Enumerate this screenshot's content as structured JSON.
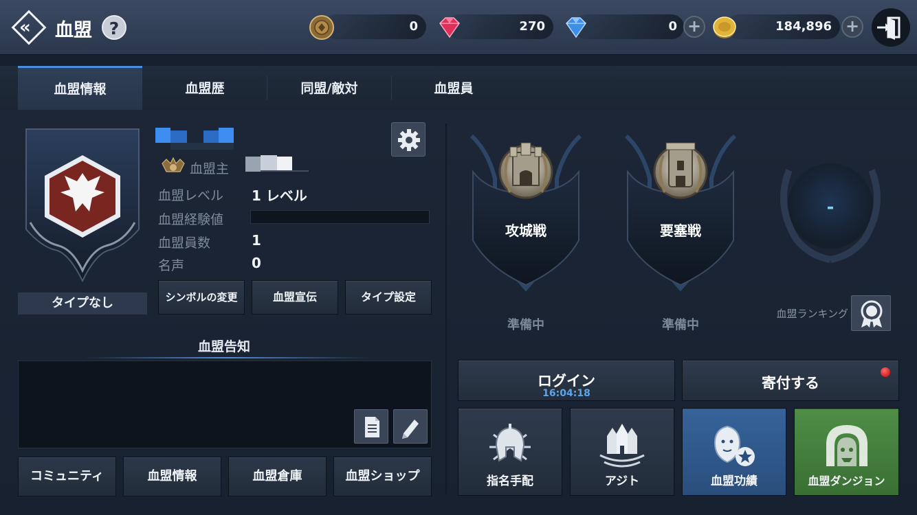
{
  "header": {
    "title": "血盟",
    "help_symbol": "?",
    "currencies": [
      {
        "icon": "medal-coin-icon",
        "value": "0",
        "color": "#b08a4a"
      },
      {
        "icon": "red-gem-icon",
        "value": "270",
        "color": "#e0305a"
      },
      {
        "icon": "blue-gem-icon",
        "value": "0",
        "color": "#3f8ee8",
        "has_plus": true
      },
      {
        "icon": "gold-coin-icon",
        "value": "184,896",
        "color": "#e2b43a",
        "has_plus": true
      }
    ]
  },
  "tabs": [
    {
      "label": "血盟情報",
      "active": true
    },
    {
      "label": "血盟歴",
      "active": false
    },
    {
      "label": "同盟/敵対",
      "active": false
    },
    {
      "label": "血盟員",
      "active": false
    }
  ],
  "clan": {
    "type_label": "タイプなし",
    "leader_label": "血盟主",
    "level_label": "血盟レベル",
    "level_value": "1 レベル",
    "exp_label": "血盟経験値",
    "exp_fraction": 0,
    "members_label": "血盟員数",
    "members_value": "1",
    "fame_label": "名声",
    "fame_value": "0",
    "buttons": {
      "symbol": "シンボルの変更",
      "promo": "血盟宣伝",
      "type": "タイプ設定"
    }
  },
  "notice": {
    "title": "血盟告知"
  },
  "bottom_left_buttons": [
    "コミュニティ",
    "血盟情報",
    "血盟倉庫",
    "血盟ショップ"
  ],
  "wars": [
    {
      "label": "攻城戦",
      "status": "準備中"
    },
    {
      "label": "要塞戦",
      "status": "準備中"
    }
  ],
  "ranking": {
    "value": "-",
    "label": "血盟ランキング"
  },
  "login": {
    "label": "ログイン",
    "timer": "16:04:18"
  },
  "donate": {
    "label": "寄付する"
  },
  "tiles": [
    {
      "label": "指名手配",
      "icon": "spartan-helmet-icon"
    },
    {
      "label": "アジト",
      "icon": "castle-icon"
    },
    {
      "label": "血盟功績",
      "icon": "lion-badge-icon",
      "accent": "#2f5a8f"
    },
    {
      "label": "血盟ダンジョン",
      "icon": "dungeon-gate-icon",
      "accent": "#3f7a3a"
    }
  ]
}
